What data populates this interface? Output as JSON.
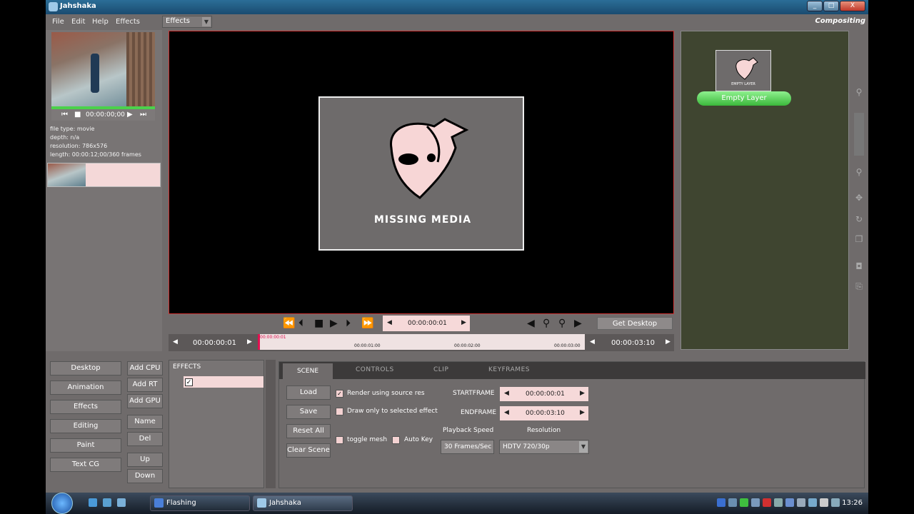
{
  "window": {
    "title": "Jahshaka",
    "min": "_",
    "max": "□",
    "close": "X"
  },
  "menu": {
    "file": "File",
    "edit": "Edit",
    "help": "Help",
    "effects": "Effects",
    "effects_select": "Effects",
    "mode": "Compositing"
  },
  "preview": {
    "timecode": "00:00:00;00",
    "file_type": "file type: movie",
    "depth": "depth: n/a",
    "resolution": "resolution: 786x576",
    "length": "length: 00:00:12;00/360 frames"
  },
  "viewer": {
    "missing_text": "MISSING MEDIA"
  },
  "transport": {
    "timecode": "00:00:00:01",
    "get_desktop": "Get Desktop"
  },
  "timeline": {
    "start": "00:00:00:01",
    "end": "00:00:03:10",
    "marker_current": "00:00:00:01",
    "marker1": "00:00:01:00",
    "marker2": "00:00:02:00",
    "marker3": "00:00:03:00"
  },
  "layers": {
    "items": [
      {
        "label": "Empty Layer",
        "thumb_text": "EMPTY LAYER"
      }
    ]
  },
  "modules": {
    "desktop": "Desktop",
    "animation": "Animation",
    "effects": "Effects",
    "editing": "Editing",
    "paint": "Paint",
    "textcg": "Text CG"
  },
  "add": {
    "cpu": "Add CPU",
    "rt": "Add RT",
    "gpu": "Add GPU",
    "name": "Name",
    "del": "Del",
    "up": "Up",
    "down": "Down"
  },
  "effects_panel": {
    "header": "EFFECTS"
  },
  "tabs": {
    "scene": "SCENE",
    "controls": "CONTROLS",
    "clip": "CLIP",
    "keyframes": "KEYFRAMES"
  },
  "scene": {
    "load": "Load",
    "save": "Save",
    "reset_all": "Reset All",
    "clear_scene": "Clear Scene",
    "render_source_res": "Render using source res",
    "draw_selected": "Draw only to selected effect",
    "toggle_mesh": "toggle mesh",
    "auto_key": "Auto Key",
    "startframe_label": "STARTFRAME",
    "startframe": "00:00:00:01",
    "endframe_label": "ENDFRAME",
    "endframe": "00:00:03:10",
    "playback_label": "Playback Speed",
    "playback": "30 Frames/Sec",
    "resolution_label": "Resolution",
    "resolution": "HDTV 720/30p"
  },
  "taskbar": {
    "task1": "Flashing",
    "task2": "Jahshaka",
    "clock": "13:26"
  }
}
